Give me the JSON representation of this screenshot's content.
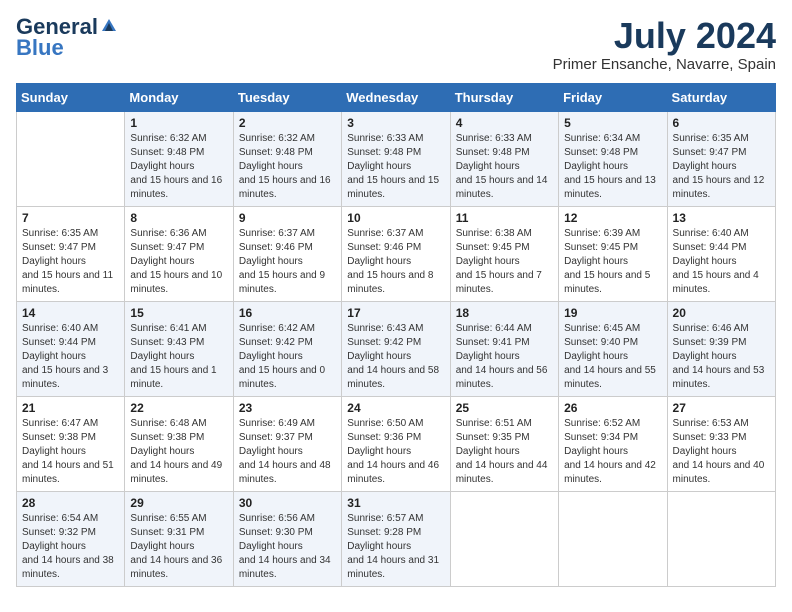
{
  "header": {
    "logo_line1": "General",
    "logo_line2": "Blue",
    "month_year": "July 2024",
    "location": "Primer Ensanche, Navarre, Spain"
  },
  "days_of_week": [
    "Sunday",
    "Monday",
    "Tuesday",
    "Wednesday",
    "Thursday",
    "Friday",
    "Saturday"
  ],
  "weeks": [
    [
      {
        "num": "",
        "sunrise": "",
        "sunset": "",
        "daylight": ""
      },
      {
        "num": "1",
        "sunrise": "6:32 AM",
        "sunset": "9:48 PM",
        "daylight": "15 hours and 16 minutes."
      },
      {
        "num": "2",
        "sunrise": "6:32 AM",
        "sunset": "9:48 PM",
        "daylight": "15 hours and 16 minutes."
      },
      {
        "num": "3",
        "sunrise": "6:33 AM",
        "sunset": "9:48 PM",
        "daylight": "15 hours and 15 minutes."
      },
      {
        "num": "4",
        "sunrise": "6:33 AM",
        "sunset": "9:48 PM",
        "daylight": "15 hours and 14 minutes."
      },
      {
        "num": "5",
        "sunrise": "6:34 AM",
        "sunset": "9:48 PM",
        "daylight": "15 hours and 13 minutes."
      },
      {
        "num": "6",
        "sunrise": "6:35 AM",
        "sunset": "9:47 PM",
        "daylight": "15 hours and 12 minutes."
      }
    ],
    [
      {
        "num": "7",
        "sunrise": "6:35 AM",
        "sunset": "9:47 PM",
        "daylight": "15 hours and 11 minutes."
      },
      {
        "num": "8",
        "sunrise": "6:36 AM",
        "sunset": "9:47 PM",
        "daylight": "15 hours and 10 minutes."
      },
      {
        "num": "9",
        "sunrise": "6:37 AM",
        "sunset": "9:46 PM",
        "daylight": "15 hours and 9 minutes."
      },
      {
        "num": "10",
        "sunrise": "6:37 AM",
        "sunset": "9:46 PM",
        "daylight": "15 hours and 8 minutes."
      },
      {
        "num": "11",
        "sunrise": "6:38 AM",
        "sunset": "9:45 PM",
        "daylight": "15 hours and 7 minutes."
      },
      {
        "num": "12",
        "sunrise": "6:39 AM",
        "sunset": "9:45 PM",
        "daylight": "15 hours and 5 minutes."
      },
      {
        "num": "13",
        "sunrise": "6:40 AM",
        "sunset": "9:44 PM",
        "daylight": "15 hours and 4 minutes."
      }
    ],
    [
      {
        "num": "14",
        "sunrise": "6:40 AM",
        "sunset": "9:44 PM",
        "daylight": "15 hours and 3 minutes."
      },
      {
        "num": "15",
        "sunrise": "6:41 AM",
        "sunset": "9:43 PM",
        "daylight": "15 hours and 1 minute."
      },
      {
        "num": "16",
        "sunrise": "6:42 AM",
        "sunset": "9:42 PM",
        "daylight": "15 hours and 0 minutes."
      },
      {
        "num": "17",
        "sunrise": "6:43 AM",
        "sunset": "9:42 PM",
        "daylight": "14 hours and 58 minutes."
      },
      {
        "num": "18",
        "sunrise": "6:44 AM",
        "sunset": "9:41 PM",
        "daylight": "14 hours and 56 minutes."
      },
      {
        "num": "19",
        "sunrise": "6:45 AM",
        "sunset": "9:40 PM",
        "daylight": "14 hours and 55 minutes."
      },
      {
        "num": "20",
        "sunrise": "6:46 AM",
        "sunset": "9:39 PM",
        "daylight": "14 hours and 53 minutes."
      }
    ],
    [
      {
        "num": "21",
        "sunrise": "6:47 AM",
        "sunset": "9:38 PM",
        "daylight": "14 hours and 51 minutes."
      },
      {
        "num": "22",
        "sunrise": "6:48 AM",
        "sunset": "9:38 PM",
        "daylight": "14 hours and 49 minutes."
      },
      {
        "num": "23",
        "sunrise": "6:49 AM",
        "sunset": "9:37 PM",
        "daylight": "14 hours and 48 minutes."
      },
      {
        "num": "24",
        "sunrise": "6:50 AM",
        "sunset": "9:36 PM",
        "daylight": "14 hours and 46 minutes."
      },
      {
        "num": "25",
        "sunrise": "6:51 AM",
        "sunset": "9:35 PM",
        "daylight": "14 hours and 44 minutes."
      },
      {
        "num": "26",
        "sunrise": "6:52 AM",
        "sunset": "9:34 PM",
        "daylight": "14 hours and 42 minutes."
      },
      {
        "num": "27",
        "sunrise": "6:53 AM",
        "sunset": "9:33 PM",
        "daylight": "14 hours and 40 minutes."
      }
    ],
    [
      {
        "num": "28",
        "sunrise": "6:54 AM",
        "sunset": "9:32 PM",
        "daylight": "14 hours and 38 minutes."
      },
      {
        "num": "29",
        "sunrise": "6:55 AM",
        "sunset": "9:31 PM",
        "daylight": "14 hours and 36 minutes."
      },
      {
        "num": "30",
        "sunrise": "6:56 AM",
        "sunset": "9:30 PM",
        "daylight": "14 hours and 34 minutes."
      },
      {
        "num": "31",
        "sunrise": "6:57 AM",
        "sunset": "9:28 PM",
        "daylight": "14 hours and 31 minutes."
      },
      {
        "num": "",
        "sunrise": "",
        "sunset": "",
        "daylight": ""
      },
      {
        "num": "",
        "sunrise": "",
        "sunset": "",
        "daylight": ""
      },
      {
        "num": "",
        "sunrise": "",
        "sunset": "",
        "daylight": ""
      }
    ]
  ]
}
